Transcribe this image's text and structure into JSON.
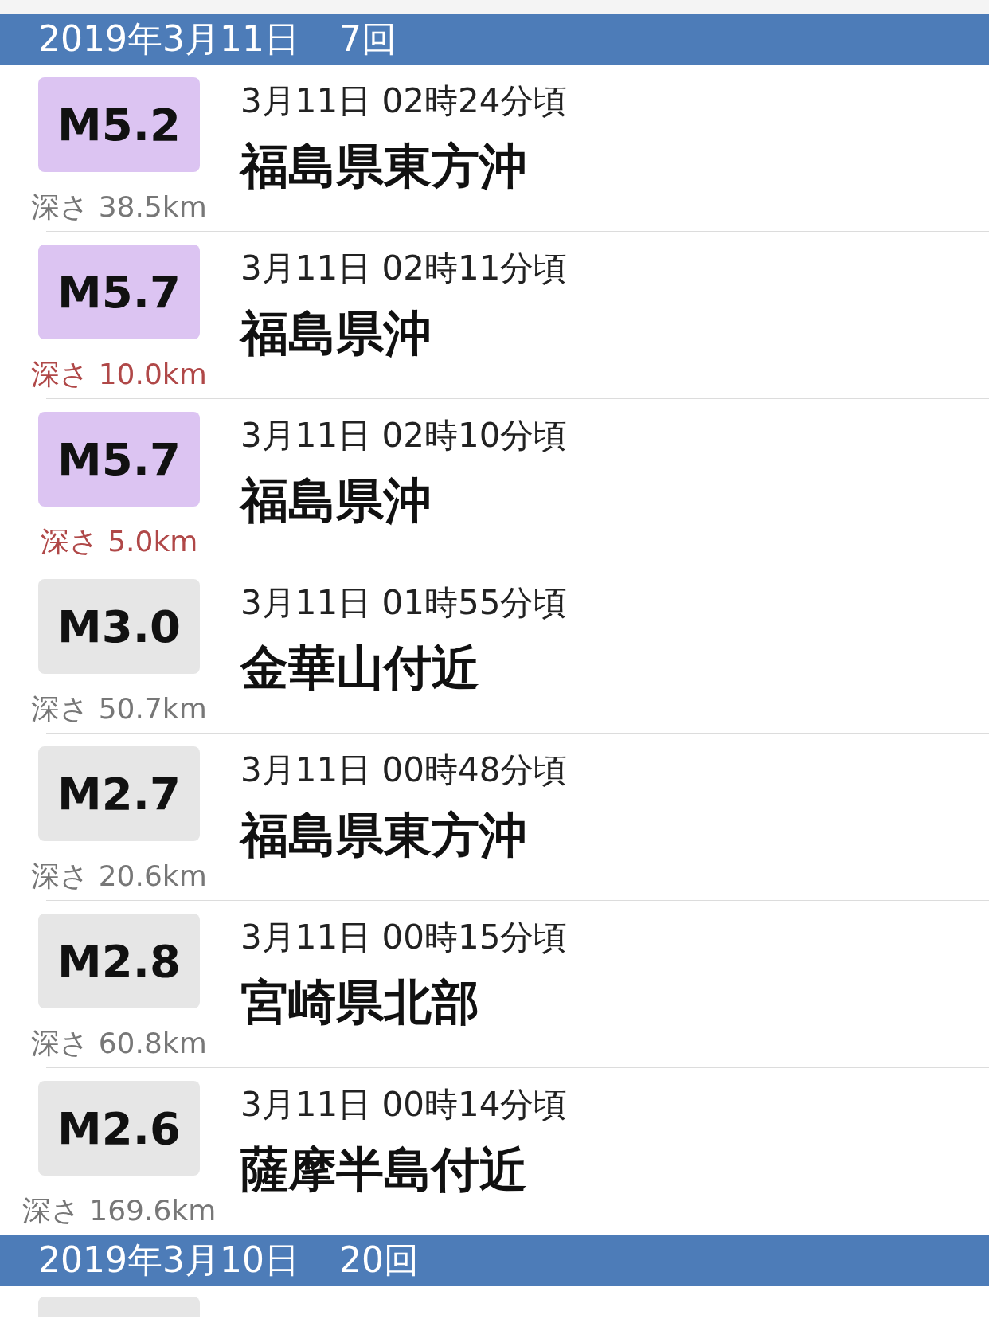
{
  "days": [
    {
      "date": "2019年3月11日",
      "count": "7回",
      "quakes": [
        {
          "magnitude": "M5.2",
          "color": "#dcc4f2",
          "depth": "深さ 38.5km",
          "shallow": false,
          "time": "3月11日 02時24分頃",
          "place": "福島県東方沖"
        },
        {
          "magnitude": "M5.7",
          "color": "#dcc4f2",
          "depth": "深さ 10.0km",
          "shallow": true,
          "time": "3月11日 02時11分頃",
          "place": "福島県沖"
        },
        {
          "magnitude": "M5.7",
          "color": "#dcc4f2",
          "depth": "深さ 5.0km",
          "shallow": true,
          "time": "3月11日 02時10分頃",
          "place": "福島県沖"
        },
        {
          "magnitude": "M3.0",
          "color": "#e6e6e6",
          "depth": "深さ 50.7km",
          "shallow": false,
          "time": "3月11日 01時55分頃",
          "place": "金華山付近"
        },
        {
          "magnitude": "M2.7",
          "color": "#e6e6e6",
          "depth": "深さ 20.6km",
          "shallow": false,
          "time": "3月11日 00時48分頃",
          "place": "福島県東方沖"
        },
        {
          "magnitude": "M2.8",
          "color": "#e6e6e6",
          "depth": "深さ 60.8km",
          "shallow": false,
          "time": "3月11日 00時15分頃",
          "place": "宮崎県北部"
        },
        {
          "magnitude": "M2.6",
          "color": "#e6e6e6",
          "depth": "深さ 169.6km",
          "shallow": false,
          "time": "3月11日 00時14分頃",
          "place": "薩摩半島付近"
        }
      ]
    },
    {
      "date": "2019年3月10日",
      "count": "20回"
    }
  ]
}
